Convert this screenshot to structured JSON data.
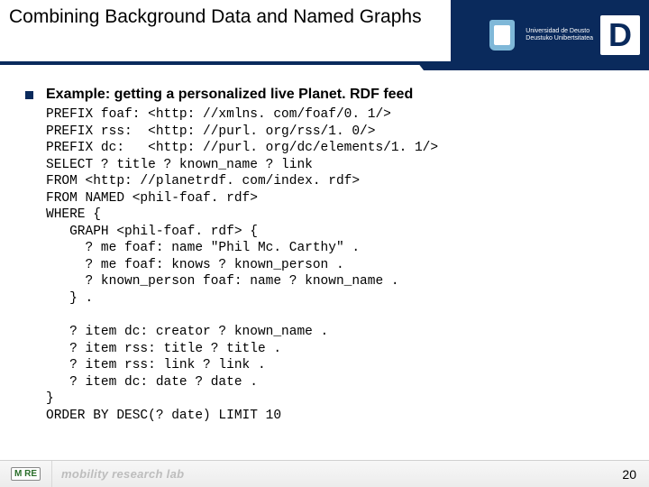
{
  "header": {
    "title": "Combining Background Data and Named Graphs",
    "university_line1": "Universidad de Deusto",
    "university_line2": "Deustuko Unibertsitatea",
    "d_letter": "D"
  },
  "content": {
    "example_label": "Example: getting a personalized live Planet. RDF feed",
    "code": "PREFIX foaf: <http: //xmlns. com/foaf/0. 1/>\nPREFIX rss:  <http: //purl. org/rss/1. 0/>\nPREFIX dc:   <http: //purl. org/dc/elements/1. 1/>\nSELECT ? title ? known_name ? link\nFROM <http: //planetrdf. com/index. rdf>\nFROM NAMED <phil-foaf. rdf>\nWHERE {\n   GRAPH <phil-foaf. rdf> {\n     ? me foaf: name \"Phil Mc. Carthy\" .\n     ? me foaf: knows ? known_person .\n     ? known_person foaf: name ? known_name .\n   } .\n\n   ? item dc: creator ? known_name .\n   ? item rss: title ? title .\n   ? item rss: link ? link .\n   ? item dc: date ? date .\n}\nORDER BY DESC(? date) LIMIT 10"
  },
  "footer": {
    "badge": "M   RE",
    "lab": "mobility research lab",
    "page": "20"
  }
}
